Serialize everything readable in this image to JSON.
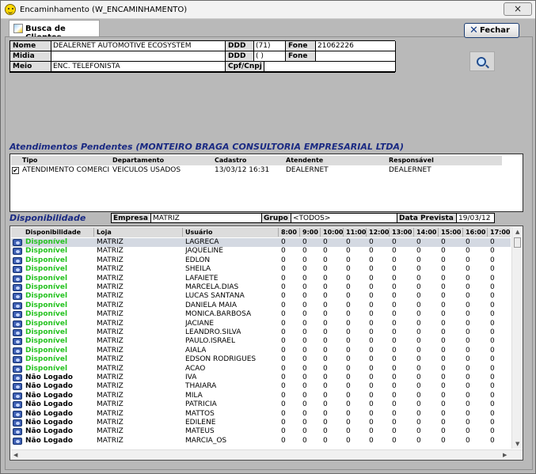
{
  "window": {
    "title": "Encaminhamento (W_ENCAMINHAMENTO)",
    "close_label": "×"
  },
  "tab": {
    "label": "Busca de Clientes"
  },
  "buttons": {
    "fechar": "Fechar"
  },
  "client": {
    "labels": [
      "Nome",
      "Midia",
      "Meio"
    ],
    "values": [
      "DEALERNET AUTOMOTIVE ECOSYSTEM",
      "",
      "ENC. TELEFONISTA"
    ],
    "ddd_label": "DDD",
    "ddd_values": [
      "(71)",
      "(   )"
    ],
    "fone_label": "Fone",
    "fone_values": [
      "21062226",
      ""
    ],
    "cpf_label": "Cpf/Cnpj",
    "cpf_value": ""
  },
  "pending": {
    "title": "Atendimentos Pendentes (MONTEIRO BRAGA CONSULTORIA EMPRESARIAL LTDA)",
    "columns": [
      "Tipo",
      "Departamento",
      "Cadastro",
      "Atendente",
      "Responsável"
    ],
    "row": [
      "ATENDIMENTO COMERCI",
      "VEICULOS USADOS",
      "13/03/12 16:31",
      "DEALERNET",
      "DEALERNET"
    ],
    "checked": "✔"
  },
  "availability": {
    "title": "Disponibilidade",
    "empresa_label": "Empresa",
    "empresa_value": "MATRIZ",
    "grupo_label": "Grupo",
    "grupo_value": "<TODOS>",
    "data_label": "Data Prevista",
    "data_value": "19/03/12",
    "columns": [
      "Disponibilidade",
      "Loja",
      "Usuário",
      "8:00",
      "9:00",
      "10:00",
      "11:00",
      "12:00",
      "13:00",
      "14:00",
      "15:00",
      "16:00",
      "17:00"
    ],
    "rows": [
      [
        "Disponível",
        "MATRIZ",
        "LAGRECA"
      ],
      [
        "Disponível",
        "MATRIZ",
        "JAQUELINE"
      ],
      [
        "Disponível",
        "MATRIZ",
        "EDLON"
      ],
      [
        "Disponível",
        "MATRIZ",
        "SHEILA"
      ],
      [
        "Disponível",
        "MATRIZ",
        "LAFAIETE"
      ],
      [
        "Disponível",
        "MATRIZ",
        "MARCELA.DIAS"
      ],
      [
        "Disponível",
        "MATRIZ",
        "LUCAS SANTANA"
      ],
      [
        "Disponível",
        "MATRIZ",
        "DANIELA MAIA"
      ],
      [
        "Disponível",
        "MATRIZ",
        "MÔNICA.BARBOSA"
      ],
      [
        "Disponível",
        "MATRIZ",
        "JACIANE"
      ],
      [
        "Disponível",
        "MATRIZ",
        "LEANDRO.SILVA"
      ],
      [
        "Disponível",
        "MATRIZ",
        "PAULO.ISRAEL"
      ],
      [
        "Disponível",
        "MATRIZ",
        "AIALA"
      ],
      [
        "Disponível",
        "MATRIZ",
        "EDSON RODRIGUES"
      ],
      [
        "Disponível",
        "MATRIZ",
        "ACAO"
      ],
      [
        "Não Logado",
        "MATRIZ",
        "IVA"
      ],
      [
        "Não Logado",
        "MATRIZ",
        "THAIARA"
      ],
      [
        "Não Logado",
        "MATRIZ",
        "MILA"
      ],
      [
        "Não Logado",
        "MATRIZ",
        "PATRÍCIA"
      ],
      [
        "Não Logado",
        "MATRIZ",
        "MATTOS"
      ],
      [
        "Não Logado",
        "MATRIZ",
        "EDILENE"
      ],
      [
        "Não Logado",
        "MATRIZ",
        "MATEUS"
      ],
      [
        "Não Logado",
        "MATRIZ",
        "MARCIA_OS"
      ]
    ],
    "hour_value": "0"
  },
  "colors": {
    "title_blue": "#1a2a83",
    "available_green": "#24c21f"
  }
}
